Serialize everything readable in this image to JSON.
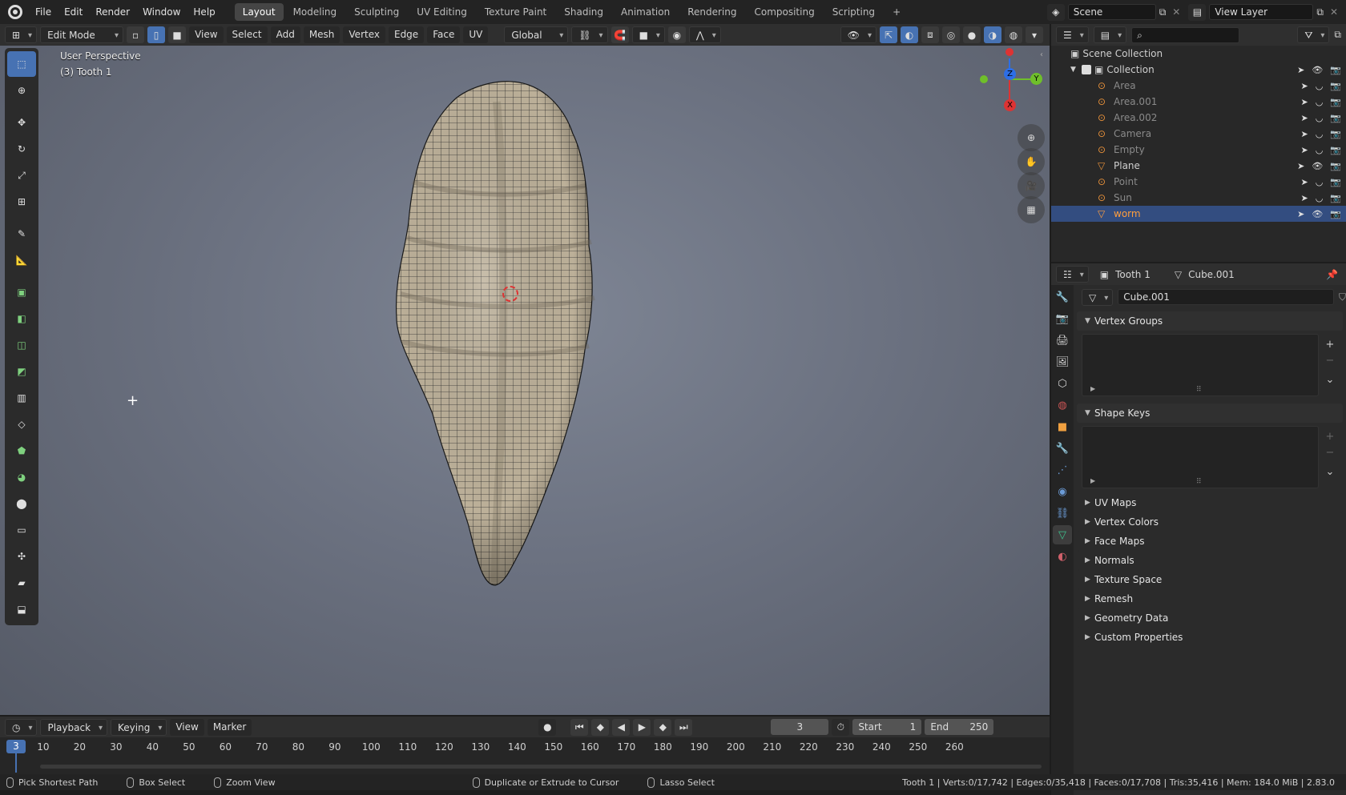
{
  "topbar": {
    "menus": [
      "File",
      "Edit",
      "Render",
      "Window",
      "Help"
    ],
    "workspaces": [
      "Layout",
      "Modeling",
      "Sculpting",
      "UV Editing",
      "Texture Paint",
      "Shading",
      "Animation",
      "Rendering",
      "Compositing",
      "Scripting"
    ],
    "active_workspace": "Layout",
    "add_tab": "+",
    "scene_name": "Scene",
    "view_layer": "View Layer"
  },
  "viewport_header": {
    "mode": "Edit Mode",
    "menus": [
      "View",
      "Select",
      "Add",
      "Mesh",
      "Vertex",
      "Edge",
      "Face",
      "UV"
    ],
    "transform_orientation": "Global"
  },
  "viewport": {
    "perspective_label": "User Perspective",
    "object_label": "(3) Tooth 1",
    "gizmo_axes": [
      "Z",
      "Y",
      "X"
    ]
  },
  "toolbar_tools": [
    "select-box",
    "cursor",
    "move",
    "rotate",
    "scale",
    "transform",
    "annotate",
    "measure",
    "add-cube",
    "extrude-region",
    "inset-faces",
    "bevel",
    "loop-cut",
    "knife",
    "poly-build",
    "spin",
    "smooth",
    "edge-slide",
    "shrink-fatten",
    "shear",
    "rip-region"
  ],
  "outliner": {
    "root": "Scene Collection",
    "collection": "Collection",
    "items": [
      {
        "name": "Area",
        "dim": true
      },
      {
        "name": "Area.001",
        "dim": true
      },
      {
        "name": "Area.002",
        "dim": true
      },
      {
        "name": "Camera",
        "dim": true
      },
      {
        "name": "Empty",
        "dim": true
      },
      {
        "name": "Plane",
        "dim": false
      },
      {
        "name": "Point",
        "dim": true
      },
      {
        "name": "Sun",
        "dim": true
      },
      {
        "name": "worm",
        "dim": false,
        "selected": true
      }
    ]
  },
  "properties": {
    "object_name": "Tooth 1",
    "mesh_name": "Cube.001",
    "datablock": "Cube.001",
    "panels_open": [
      "Vertex Groups",
      "Shape Keys"
    ],
    "panels_closed": [
      "UV Maps",
      "Vertex Colors",
      "Face Maps",
      "Normals",
      "Texture Space",
      "Remesh",
      "Geometry Data",
      "Custom Properties"
    ]
  },
  "timeline": {
    "menus": [
      "Playback",
      "Keying",
      "View",
      "Marker"
    ],
    "current_frame": "3",
    "start_label": "Start",
    "start": "1",
    "end_label": "End",
    "end": "250",
    "ticks": [
      "10",
      "20",
      "30",
      "40",
      "50",
      "60",
      "70",
      "80",
      "90",
      "100",
      "110",
      "120",
      "130",
      "140",
      "150",
      "160",
      "170",
      "180",
      "190",
      "200",
      "210",
      "220",
      "230",
      "240",
      "250",
      "260"
    ],
    "playhead": "3"
  },
  "statusbar": {
    "hints": [
      "Pick Shortest Path",
      "Box Select",
      "Zoom View",
      "Duplicate or Extrude to Cursor",
      "Lasso Select"
    ],
    "stats": "Tooth 1 | Verts:0/17,742 | Edges:0/35,418 | Faces:0/17,708 | Tris:35,416 | Mem: 184.0 MiB | 2.83.0"
  },
  "colors": {
    "accent": "#4772b3",
    "selected_object": "#ff9e3d",
    "mesh_fill": "#bfb49d",
    "wire": "#2a2a2a"
  }
}
